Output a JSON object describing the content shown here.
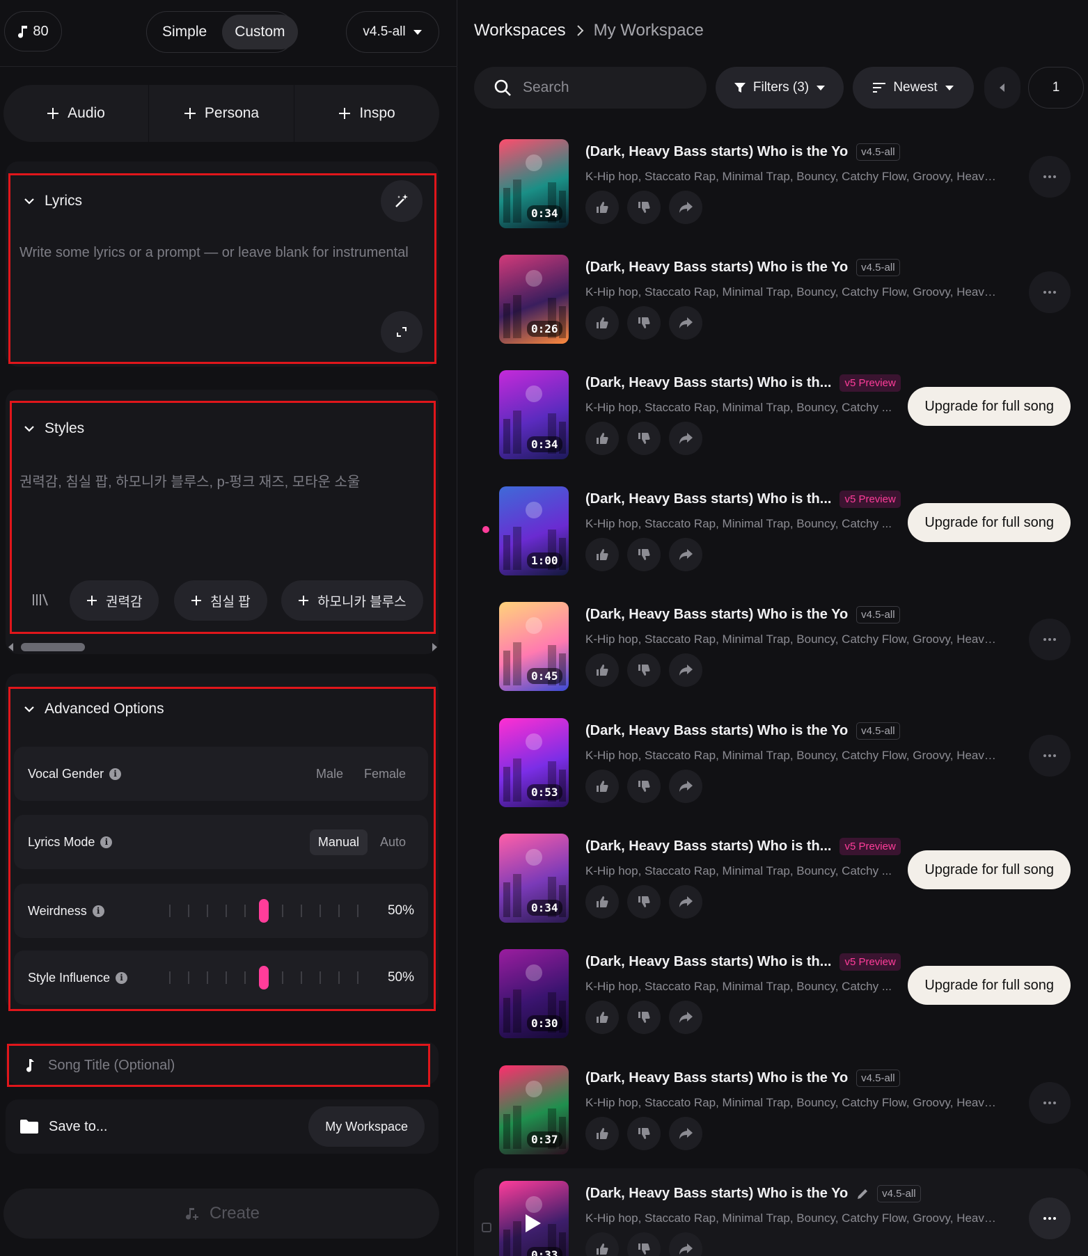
{
  "header": {
    "credits": "80",
    "modes": [
      "Simple",
      "Custom"
    ],
    "active_mode": "Custom",
    "version": "v4.5-all"
  },
  "add_buttons": [
    "Audio",
    "Persona",
    "Inspo"
  ],
  "lyrics": {
    "title": "Lyrics",
    "placeholder": "Write some lyrics or a prompt — or leave blank for instrumental"
  },
  "styles": {
    "title": "Styles",
    "placeholder": "권력감, 침실 팝, 하모니카 블루스, p-펑크 재즈, 모타운 소울",
    "chips": [
      "권력감",
      "침실 팝",
      "하모니카 블루스"
    ]
  },
  "advanced": {
    "title": "Advanced Options",
    "vocal_gender": {
      "label": "Vocal Gender",
      "options": [
        "Male",
        "Female"
      ]
    },
    "lyrics_mode": {
      "label": "Lyrics Mode",
      "options": [
        "Manual",
        "Auto"
      ],
      "selected": "Manual"
    },
    "weirdness": {
      "label": "Weirdness",
      "value": "50%"
    },
    "style_influence": {
      "label": "Style Influence",
      "value": "50%"
    }
  },
  "song_title": {
    "placeholder": "Song Title (Optional)"
  },
  "save": {
    "label": "Save to...",
    "workspace": "My Workspace"
  },
  "create_label": "Create",
  "breadcrumb": {
    "root": "Workspaces",
    "current": "My Workspace"
  },
  "toolbar": {
    "search_placeholder": "Search",
    "filters": "Filters (3)",
    "sort": "Newest",
    "page": "1"
  },
  "upgrade_label": "Upgrade for full song",
  "colors": {
    "accent_pink": "#ff3d9a",
    "highlight_red": "#e0161b"
  },
  "songs": [
    {
      "title": "(Dark, Heavy Bass starts) Who is the Yo",
      "badge": "v4.5-all",
      "tags": "K-Hip hop, Staccato Rap, Minimal Trap, Bouncy, Catchy Flow, Groovy, Heavy...",
      "duration": "0:34",
      "action": "more"
    },
    {
      "title": "(Dark, Heavy Bass starts) Who is the Yo",
      "badge": "v4.5-all",
      "tags": "K-Hip hop, Staccato Rap, Minimal Trap, Bouncy, Catchy Flow, Groovy, Heavy...",
      "duration": "0:26",
      "action": "more"
    },
    {
      "title": "(Dark, Heavy Bass starts) Who is th...",
      "badge": "v5 Preview",
      "tags": "K-Hip hop, Staccato Rap, Minimal Trap, Bouncy, Catchy ...",
      "duration": "0:34",
      "action": "upgrade"
    },
    {
      "title": "(Dark, Heavy Bass starts) Who is th...",
      "badge": "v5 Preview",
      "tags": "K-Hip hop, Staccato Rap, Minimal Trap, Bouncy, Catchy ...",
      "duration": "1:00",
      "action": "upgrade"
    },
    {
      "title": "(Dark, Heavy Bass starts) Who is the Yo",
      "badge": "v4.5-all",
      "tags": "K-Hip hop, Staccato Rap, Minimal Trap, Bouncy, Catchy Flow, Groovy, Heavy...",
      "duration": "0:45",
      "action": "more"
    },
    {
      "title": "(Dark, Heavy Bass starts) Who is the Yo",
      "badge": "v4.5-all",
      "tags": "K-Hip hop, Staccato Rap, Minimal Trap, Bouncy, Catchy Flow, Groovy, Heavy...",
      "duration": "0:53",
      "action": "more"
    },
    {
      "title": "(Dark, Heavy Bass starts) Who is th...",
      "badge": "v5 Preview",
      "tags": "K-Hip hop, Staccato Rap, Minimal Trap, Bouncy, Catchy ...",
      "duration": "0:34",
      "action": "upgrade"
    },
    {
      "title": "(Dark, Heavy Bass starts) Who is th...",
      "badge": "v5 Preview",
      "tags": "K-Hip hop, Staccato Rap, Minimal Trap, Bouncy, Catchy ...",
      "duration": "0:30",
      "action": "upgrade"
    },
    {
      "title": "(Dark, Heavy Bass starts) Who is the Yo",
      "badge": "v4.5-all",
      "tags": "K-Hip hop, Staccato Rap, Minimal Trap, Bouncy, Catchy Flow, Groovy, Heavy...",
      "duration": "0:37",
      "action": "more"
    },
    {
      "title": "(Dark, Heavy Bass starts) Who is the Yo",
      "badge": "v4.5-all",
      "tags": "K-Hip hop, Staccato Rap, Minimal Trap, Bouncy, Catchy Flow, Groovy, Heavy...",
      "duration": "0:33",
      "action": "more"
    }
  ]
}
